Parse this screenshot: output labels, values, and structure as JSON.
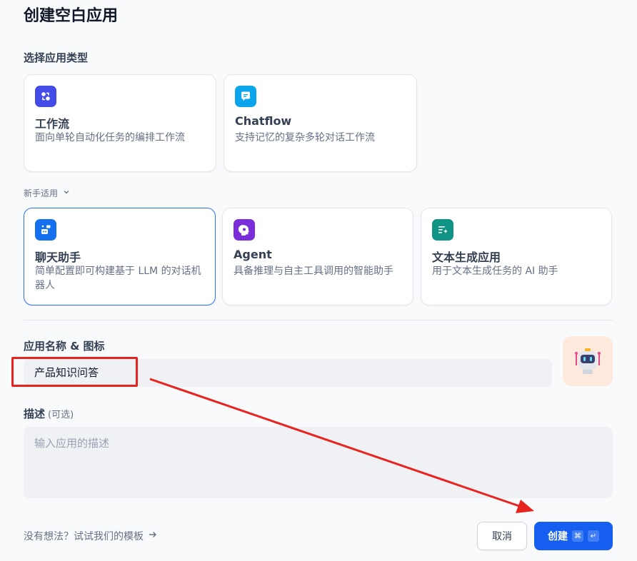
{
  "dialog": {
    "title": "创建空白应用",
    "select_type_label": "选择应用类型",
    "beginner_label": "新手适用",
    "name_icon_label": "应用名称 & 图标",
    "name_value": "产品知识问答",
    "description_label": "描述",
    "description_optional": "(可选)",
    "description_placeholder": "输入应用的描述",
    "template_link": "没有想法？试试我们的模板",
    "cancel_label": "取消",
    "create_label": "创建",
    "create_shortcut_cmd": "⌘",
    "create_shortcut_enter": "↵"
  },
  "app_types": [
    {
      "title": "工作流",
      "desc": "面向单轮自动化任务的编排工作流",
      "icon": "workflow-icon",
      "color": "#444ce7"
    },
    {
      "title": "Chatflow",
      "desc": "支持记忆的复杂多轮对话工作流",
      "icon": "chatflow-icon",
      "color": "#0ba5ec"
    }
  ],
  "beginner_types": [
    {
      "title": "聊天助手",
      "desc": "简单配置即可构建基于 LLM 的对话机器人",
      "icon": "chatbot-icon",
      "color": "#1570ef",
      "selected": true
    },
    {
      "title": "Agent",
      "desc": "具备推理与自主工具调用的智能助手",
      "icon": "agent-icon",
      "color": "#7a2ed9",
      "selected": false
    },
    {
      "title": "文本生成应用",
      "desc": "用于文本生成任务的 AI 助手",
      "icon": "text-gen-icon",
      "color": "#0e9384",
      "selected": false
    }
  ],
  "colors": {
    "accent": "#155eef",
    "selected_border": "#2970ff",
    "annotation": "#e8241f",
    "app_icon_bg": "#fdeadd"
  }
}
